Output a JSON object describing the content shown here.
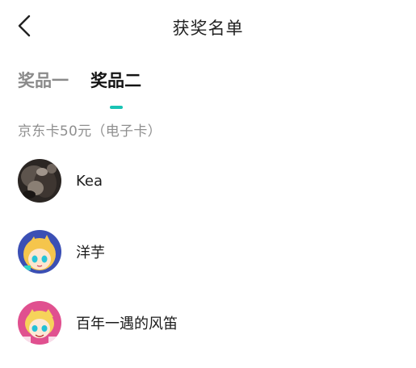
{
  "header": {
    "title": "获奖名单",
    "back_icon": "chevron-left-icon"
  },
  "tabs": [
    {
      "label": "奖品一",
      "active": false
    },
    {
      "label": "奖品二",
      "active": true
    }
  ],
  "accent_color": "#19c3b4",
  "prize": {
    "name": "京东卡50元（电子卡）"
  },
  "winners": [
    {
      "name": "Kea",
      "avatar": "dark-photo-avatar"
    },
    {
      "name": "洋芋",
      "avatar": "anime-blue-avatar"
    },
    {
      "name": "百年一遇的风笛",
      "avatar": "anime-pink-avatar"
    }
  ]
}
